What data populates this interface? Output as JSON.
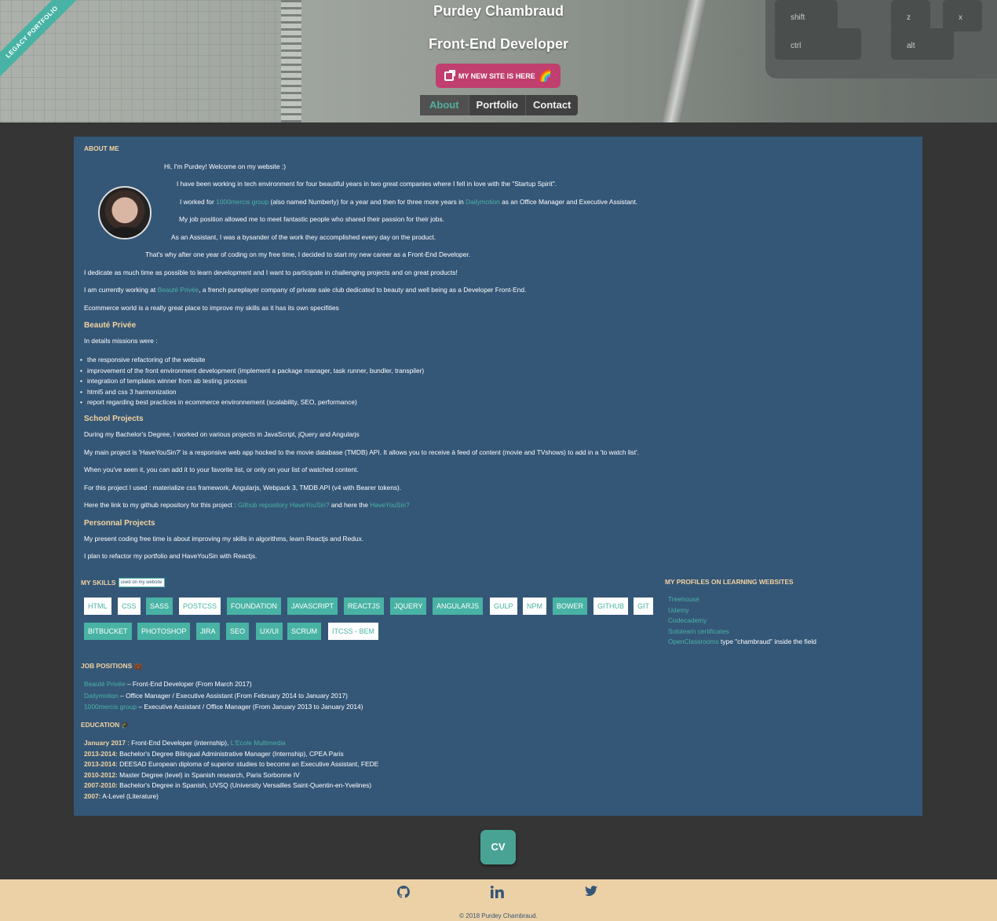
{
  "header": {
    "ribbon": "LEGACY PORTFOLIO",
    "name": "Purdey Chambraud",
    "subtitle": "Front-End Developer",
    "new_site_button": "MY NEW SITE IS HERE",
    "keys": [
      "shift",
      "z",
      "x",
      "ctrl",
      "alt"
    ],
    "nav": [
      "About",
      "Portfolio",
      "Contact"
    ]
  },
  "about": {
    "heading": "ABOUT ME",
    "intro": "Hi, I'm Purdey! Welcome on my website :)",
    "p1": "I have been working in tech environment for four beautiful years in two great companies where I fell in love with the \"Startup Spirit\".",
    "p2_pre": "I worked for ",
    "p2_link1": "1000mercis group",
    "p2_mid": " (also named Numberly) for a year and then for three more years in ",
    "p2_link2": "Dailymotion",
    "p2_post": " as an Office Manager and Executive Assistant.",
    "p3": "My job position allowed me to meet fantastic people who shared their passion for their jobs.",
    "p4": "As an Assistant, I was a bysander of the work they accomplished every day on the product.",
    "p5": "That's why after one year of coding on my free time, I decided to start my new career as a Front-End Developer.",
    "p6": "I dedicate as much time as possible to learn development and I want to participate in challenging projects and on great products!",
    "p7_pre": "I am currently working at ",
    "p7_link": "Beauté Privée",
    "p7_post": ", a french pureplayer company of private sale club dedicated to beauty and well being as a Developer Front-End.",
    "p8": "Ecommerce world is a really great place to improve my skills as it has its own specifities",
    "bp_heading": "Beauté Privée",
    "bp_intro": "In details missions were :",
    "missions": [
      "the responsive refactoring of the website",
      "improvement of the front environment development (implement a package manager, task runner, bundler, transpiler)",
      "integration of templates winner from ab testing process",
      "html5 and css 3 harmonization",
      "report regarding best practices in ecommerce environnement (scalability, SEO, performance)"
    ],
    "school_heading": "School Projects",
    "s1": "During my Bachelor's Degree, I worked on various projects in JavaScript, jQuery and Angularjs",
    "s2": "My main project is 'HaveYouSin?' is a responsive web app hocked to the movie database (TMDB) API. It allows you to receive à feed of content (movie and TVshows) to add in a 'to watch list'.",
    "s3": "When you've seen it, you can add it to your favorite list, or only on your list of watched content.",
    "s4": "For this project I used : materialize css framework, Angularjs, Webpack 3, TMDB API (v4 with Bearer tokens).",
    "s5_pre": "Here the link to my github repository for this project : ",
    "s5_link1": "Github repository HaveYouSin?",
    "s5_mid": " and here the ",
    "s5_link2": "HaveYouSin?",
    "personal_heading": "Personnal Projects",
    "pp1": "My present coding free time is about improving my skills in algorithms, learn Reactjs and Redux.",
    "pp2": "I plan to refactor my portfolio and HaveYouSin with Reactjs."
  },
  "skills": {
    "heading": "MY SKILLS",
    "badge": "used on my website",
    "tags": [
      {
        "label": "HTML",
        "style": "white"
      },
      {
        "label": "CSS",
        "style": "white"
      },
      {
        "label": "SASS",
        "style": "teal"
      },
      {
        "label": "POSTCSS",
        "style": "white"
      },
      {
        "label": "FOUNDATION",
        "style": "teal"
      },
      {
        "label": "JAVASCRIPT",
        "style": "teal"
      },
      {
        "label": "REACTJS",
        "style": "teal"
      },
      {
        "label": "JQUERY",
        "style": "teal"
      },
      {
        "label": "ANGULARJS",
        "style": "teal"
      },
      {
        "label": "GULP",
        "style": "white"
      },
      {
        "label": "NPM",
        "style": "white"
      },
      {
        "label": "BOWER",
        "style": "teal"
      },
      {
        "label": "GITHUB",
        "style": "white"
      },
      {
        "label": "GIT",
        "style": "white"
      },
      {
        "label": "BITBUCKET",
        "style": "teal"
      },
      {
        "label": "PHOTOSHOP",
        "style": "teal"
      },
      {
        "label": "JIRA",
        "style": "teal"
      },
      {
        "label": "SEO",
        "style": "teal"
      },
      {
        "label": "UX/UI",
        "style": "teal"
      },
      {
        "label": "SCRUM",
        "style": "teal"
      },
      {
        "label": "ITCSS - BEM",
        "style": "white"
      }
    ]
  },
  "profiles": {
    "heading": "MY PROFILES ON LEARNING WEBSITES",
    "items": [
      "Treehouse",
      "Udemy",
      "Codecademy",
      "Sololearn certificates",
      "OpenClassrooms"
    ],
    "openclassrooms_note": " type \"chambraud\" inside the field"
  },
  "jobs": {
    "heading": "JOB POSITIONS",
    "items": [
      {
        "company": "Beauté Privée",
        "desc": " – Front-End Developer (From March 2017)"
      },
      {
        "company": "Dailymotion",
        "desc": " – Office Manager / Executive Assistant (From February 2014 to January 2017)"
      },
      {
        "company": "1000mercis group",
        "desc": " – Executive Assistant / Office Manager (From January 2013 to January 2014)"
      }
    ]
  },
  "education": {
    "heading": "EDUCATION",
    "items": [
      {
        "year": "January 2017",
        "desc": " : Front-End Developer (internship), ",
        "link": "L'Ecole Multimedia"
      },
      {
        "year": "2013-2014:",
        "desc": " Bachelor's Degree Bilingual Administrative Manager (Internship), CPEA Paris",
        "link": ""
      },
      {
        "year": "2013-2014:",
        "desc": " DEESAD European diploma of superior studies to become an Executive Assistant, FEDE",
        "link": ""
      },
      {
        "year": "2010-2012:",
        "desc": " Master Degree (level) in Spanish research, Paris Sorbonne IV",
        "link": ""
      },
      {
        "year": "2007-2010:",
        "desc": " Bachelor's Degree in Spanish, UVSQ (University Versailles Saint-Quentin-en-Yvelines)",
        "link": ""
      },
      {
        "year": "2007:",
        "desc": " A-Level (Literature)",
        "link": ""
      }
    ]
  },
  "cv_button": "CV",
  "footer": {
    "social": [
      "github-icon",
      "linkedin-icon",
      "twitter-icon"
    ],
    "copyright": "© 2018 Purdey Chambraud."
  },
  "colors": {
    "accent": "#48b3a4",
    "panel": "#355777",
    "heading": "#f1d3a0",
    "footer": "#ecd1a6",
    "pink": "#c03f6e"
  }
}
